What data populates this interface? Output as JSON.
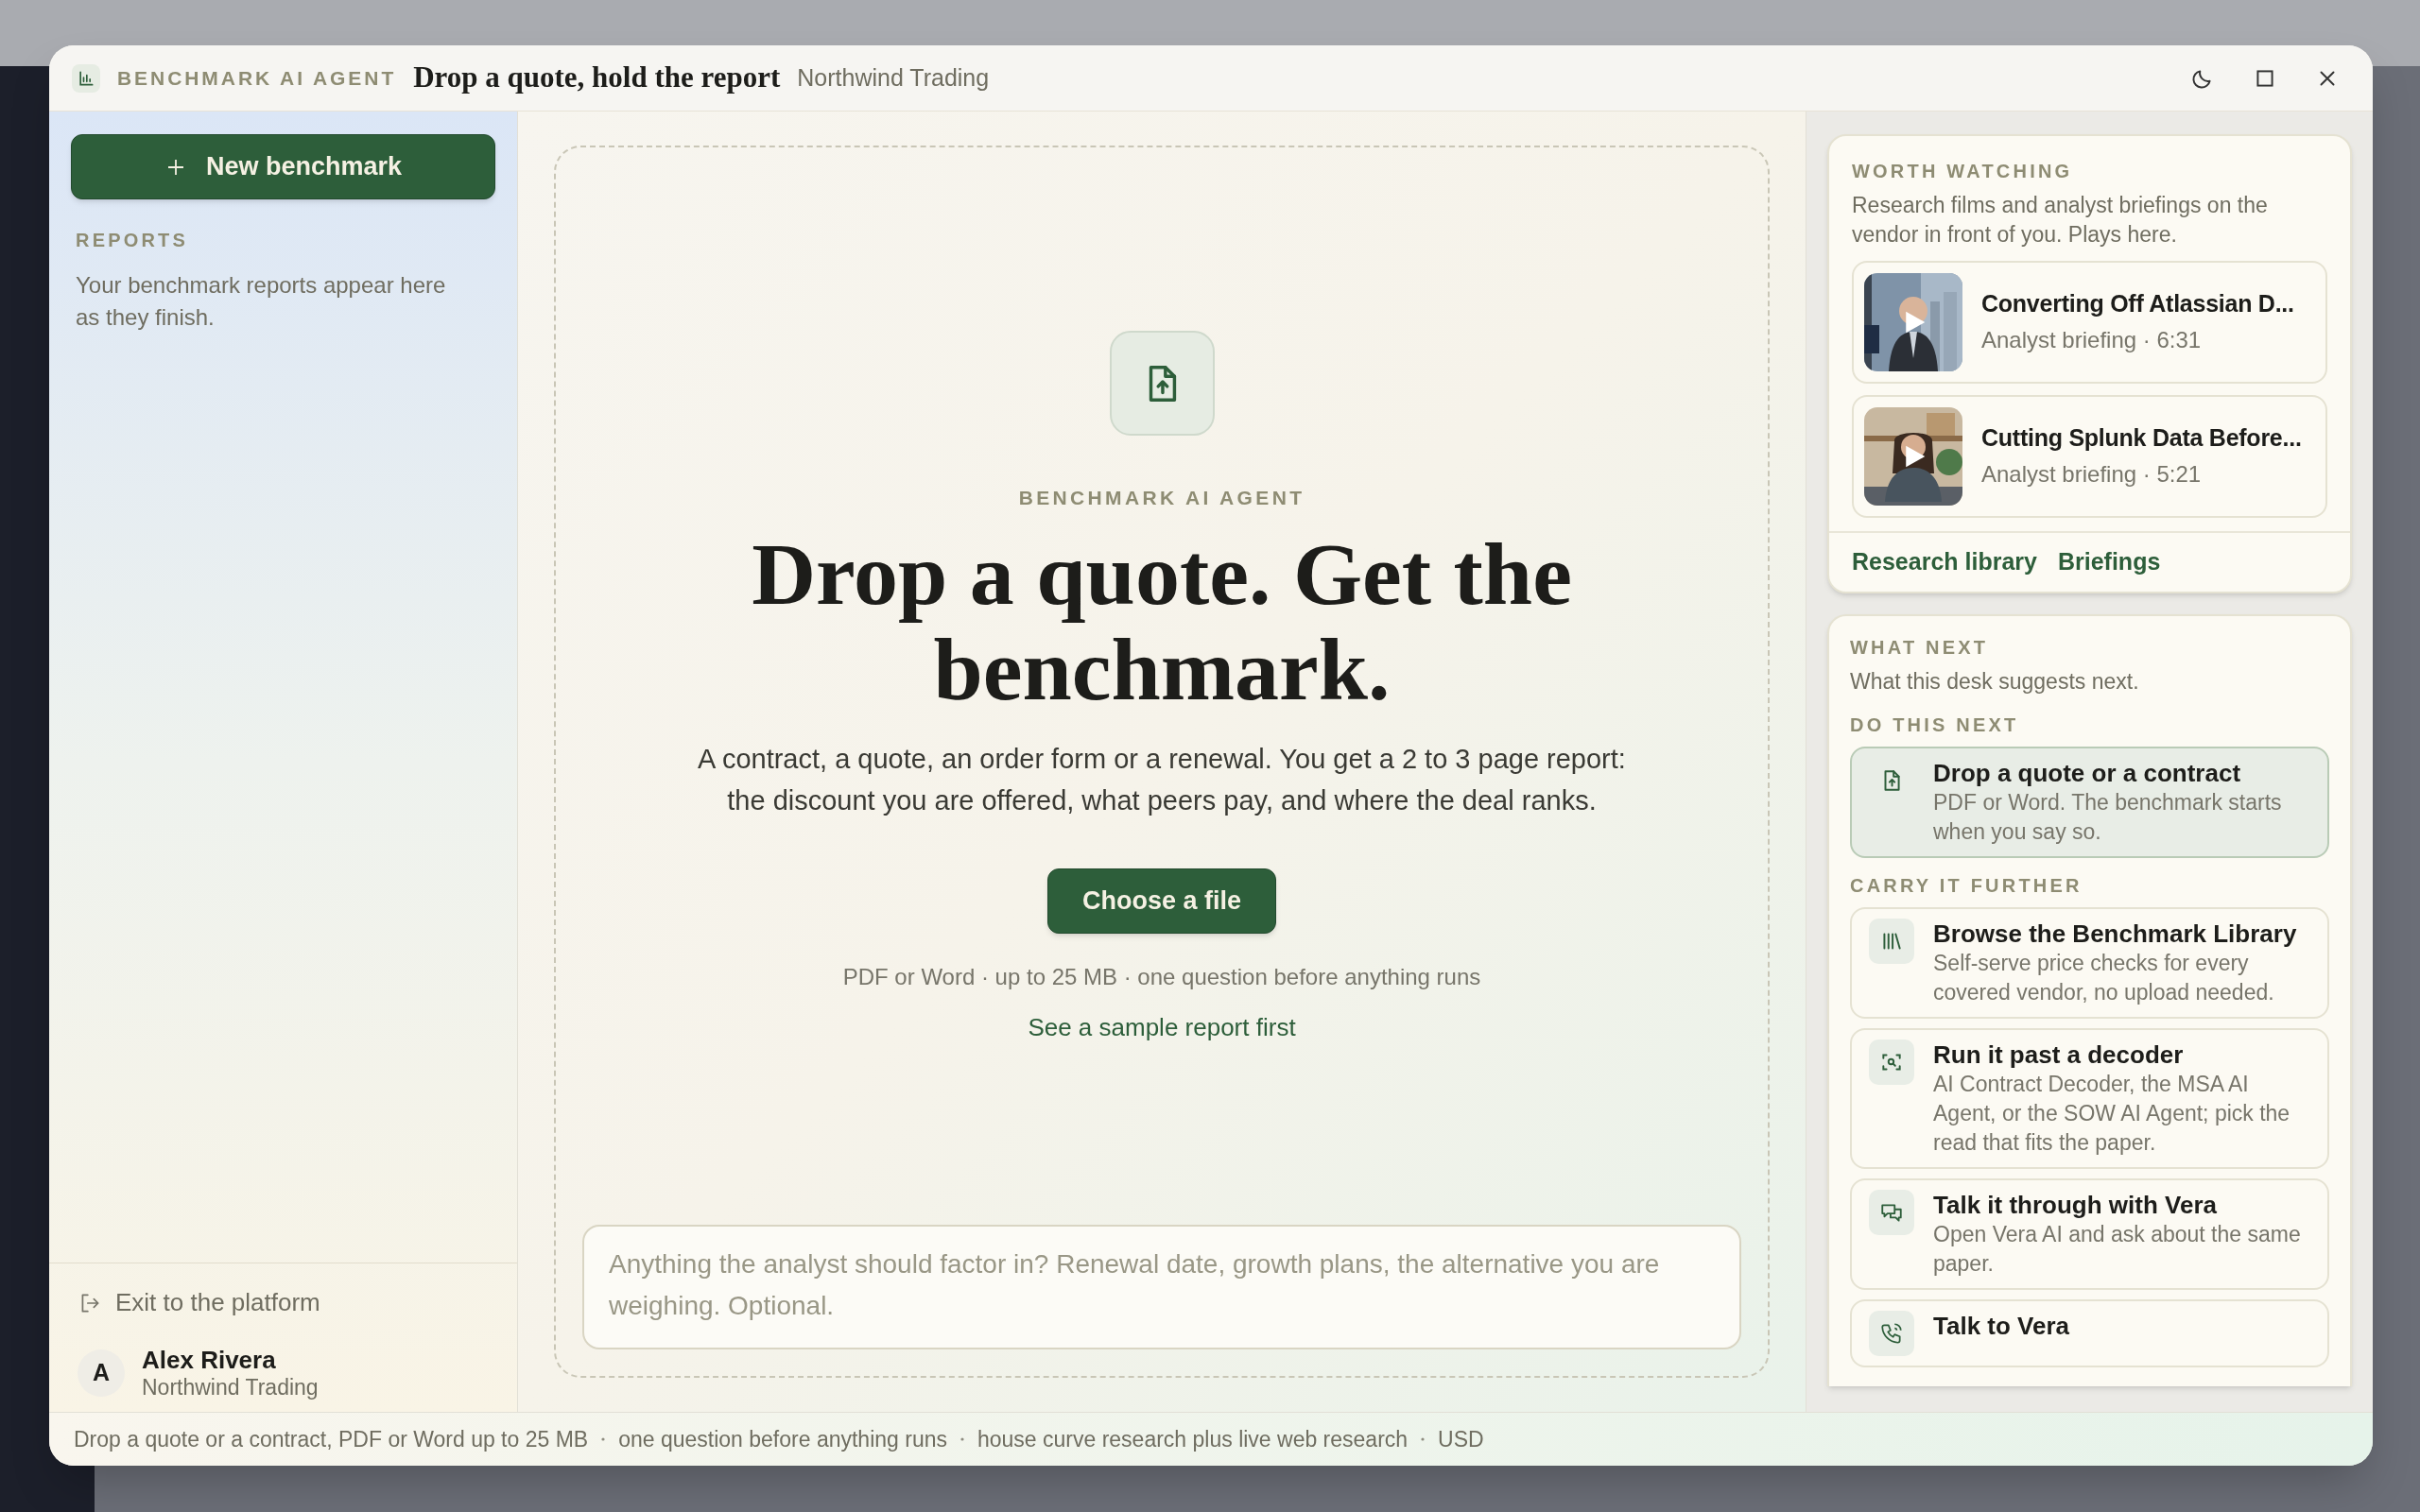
{
  "window": {
    "eyebrow": "BENCHMARK AI AGENT",
    "title": "Drop a quote, hold the report",
    "workspace": "Northwind Trading"
  },
  "sidebar": {
    "new_button": "New benchmark",
    "section_label": "REPORTS",
    "empty_text": "Your benchmark reports appear here as they finish.",
    "exit_link": "Exit to the platform",
    "user": {
      "initial": "A",
      "name": "Alex Rivera",
      "org": "Northwind Trading"
    }
  },
  "dropzone": {
    "eyebrow": "BENCHMARK AI AGENT",
    "headline": "Drop a quote. Get the benchmark.",
    "description": "A contract, a quote, an order form or a renewal. You get a 2 to 3 page report: the discount you are offered, what peers pay, and where the deal ranks.",
    "button": "Choose a file",
    "meta": "PDF or Word · up to 25 MB · one question before anything runs",
    "sample_link": "See a sample report first",
    "notes": {
      "placeholder": "Anything the analyst should factor in? Renewal date, growth plans, the alternative you are weighing. Optional."
    }
  },
  "worth_watching": {
    "label": "WORTH WATCHING",
    "description": "Research films and analyst briefings on the vendor in front of you. Plays here.",
    "videos": [
      {
        "title": "Converting Off Atlassian D...",
        "meta": "Analyst briefing · 6:31",
        "kind": "office"
      },
      {
        "title": "Cutting Splunk Data Before...",
        "meta": "Analyst briefing · 5:21",
        "kind": "desk"
      }
    ],
    "links": [
      "Research library",
      "Briefings"
    ]
  },
  "what_next": {
    "label": "WHAT NEXT",
    "description": "What this desk suggests next.",
    "groups": [
      {
        "label": "DO THIS NEXT",
        "items": [
          {
            "kind": "upload",
            "title": "Drop a quote or a contract",
            "text": "PDF or Word. The benchmark starts when you say so.",
            "selected": true
          }
        ]
      },
      {
        "label": "CARRY IT FURTHER",
        "items": [
          {
            "kind": "library",
            "title": "Browse the Benchmark Library",
            "text": "Self-serve price checks for every covered vendor, no upload needed.",
            "selected": false
          },
          {
            "kind": "scan",
            "title": "Run it past a decoder",
            "text": "AI Contract Decoder, the MSA AI Agent, or the SOW AI Agent; pick the read that fits the paper.",
            "selected": false
          },
          {
            "kind": "chat",
            "title": "Talk it through with Vera",
            "text": "Open Vera AI and ask about the same paper.",
            "selected": false
          },
          {
            "kind": "phone",
            "title": "Talk to Vera",
            "selected": false
          }
        ]
      }
    ]
  },
  "status_bar": [
    "Drop a quote or a contract, PDF or Word up to 25 MB",
    "one question before anything runs",
    "house curve research plus live web research",
    "USD"
  ]
}
